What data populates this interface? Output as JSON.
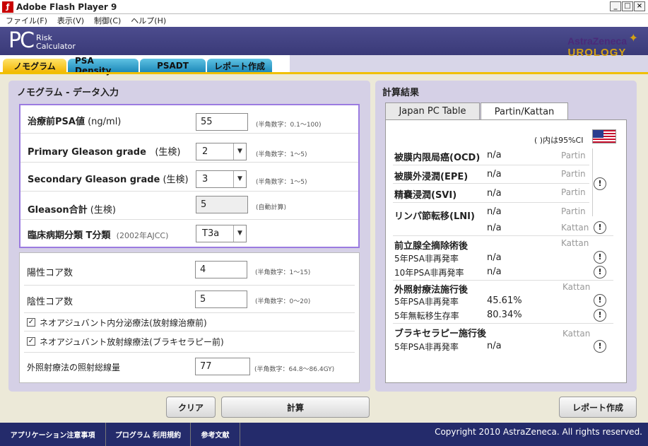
{
  "window": {
    "title": "Adobe Flash Player 9"
  },
  "menu": [
    "ファイル(F)",
    "表示(V)",
    "制御(C)",
    "ヘルプ(H)"
  ],
  "header": {
    "logo_pc": "PC",
    "logo_sub1": "Risk",
    "logo_sub2": "Calculator",
    "brand": "AstraZeneca",
    "brand_sub": "UROLOGY"
  },
  "tabs": [
    "ノモグラム",
    "PSA Density",
    "PSADT",
    "レポート作成"
  ],
  "left": {
    "title": "ノモグラム - データ入力",
    "psa": {
      "label": "治療前PSA値",
      "unit": "(ng/ml)",
      "value": "55",
      "hint": "(半角数字：0.1～100)"
    },
    "primary": {
      "label": "Primary Gleason grade",
      "sub": "(生検)",
      "value": "2",
      "hint": "(半角数字：1～5)"
    },
    "secondary": {
      "label": "Secondary Gleason grade",
      "sub": "(生検)",
      "value": "3",
      "hint": "(半角数字：1～5)"
    },
    "gleason_sum": {
      "label": "Gleason合計",
      "sub": "(生検)",
      "value": "5",
      "hint": "(自動計算)"
    },
    "stage": {
      "label": "臨床病期分類 T分類",
      "sub": "(2002年AJCC)",
      "value": "T3a"
    },
    "positive_cores": {
      "label": "陽性コア数",
      "value": "4",
      "hint": "(半角数字：1～15)"
    },
    "negative_cores": {
      "label": "陰性コア数",
      "value": "5",
      "hint": "(半角数字：0～20)"
    },
    "neo_hormone": {
      "label": "ネオアジュバント内分泌療法(放射線治療前)",
      "checked": "✓"
    },
    "neo_radiation": {
      "label": "ネオアジュバント放射線療法(ブラキセラピー前)",
      "checked": "✓"
    },
    "dose": {
      "label": "外照射療法の照射総線量",
      "value": "77",
      "hint": "(半角数字：64.8～86.4GY)"
    }
  },
  "buttons": {
    "clear": "クリア",
    "calc": "計算",
    "report": "レポート作成"
  },
  "right": {
    "title": "計算結果",
    "tab1": "Japan PC Table",
    "tab2": "Partin/Kattan",
    "ci_note": "( )内は95%CI",
    "ocd": {
      "label": "被膜内限局癌(OCD)",
      "value": "n/a",
      "src": "Partin"
    },
    "epe": {
      "label": "被膜外浸潤(EPE)",
      "value": "n/a",
      "src": "Partin"
    },
    "svi": {
      "label": "精嚢浸潤(SVI)",
      "value": "n/a",
      "src": "Partin"
    },
    "lni": {
      "label": "リンパ節転移(LNI)",
      "value1": "n/a",
      "src1": "Partin",
      "value2": "n/a",
      "src2": "Kattan"
    },
    "rp": {
      "label": "前立腺全摘除術後",
      "src": "Kattan",
      "psa5_label": "5年PSA非再発率",
      "psa5": "n/a",
      "psa10_label": "10年PSA非再発率",
      "psa10": "n/a"
    },
    "ebrt": {
      "label": "外照射療法施行後",
      "src": "Kattan",
      "psa5_label": "5年PSA非再発率",
      "psa5": "45.61%",
      "met5_label": "5年無転移生存率",
      "met5": "80.34%"
    },
    "brachy": {
      "label": "ブラキセラピー施行後",
      "src": "Kattan",
      "psa5_label": "5年PSA非再発率",
      "psa5": "n/a"
    },
    "info_icon": "!"
  },
  "footer": {
    "link1": "アプリケーション注意事項",
    "link2": "プログラム 利用規約",
    "link3": "参考文献",
    "copyright": "Copyright 2010 AstraZeneca. All rights reserved."
  }
}
